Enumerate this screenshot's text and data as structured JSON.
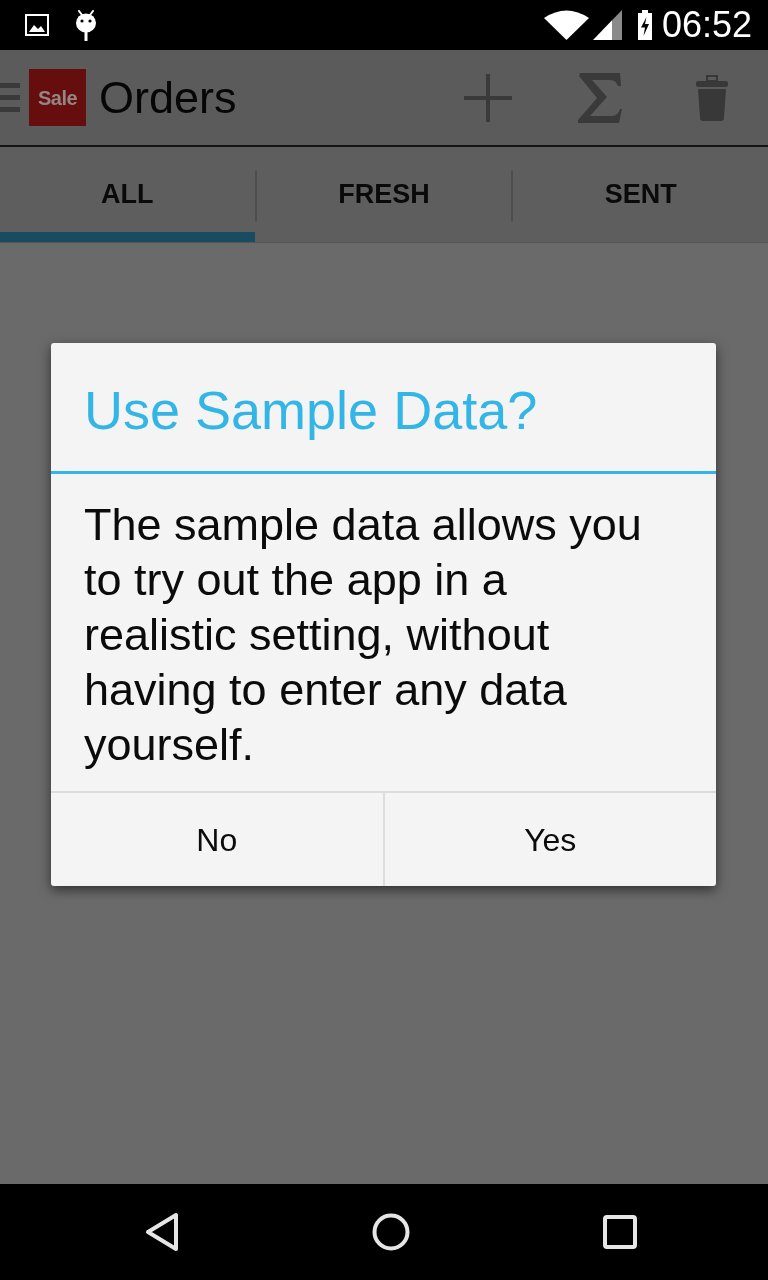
{
  "status_bar": {
    "time": "06:52"
  },
  "app_bar": {
    "logo_text": "Sale",
    "title": "Orders"
  },
  "tabs": [
    {
      "label": "ALL",
      "selected": true
    },
    {
      "label": "FRESH",
      "selected": false
    },
    {
      "label": "SENT",
      "selected": false
    }
  ],
  "dialog": {
    "title": "Use Sample Data?",
    "message": "The sample data allows you to try out the app in a realistic setting, without having to enter any data yourself.",
    "buttons": [
      "No",
      "Yes"
    ]
  }
}
